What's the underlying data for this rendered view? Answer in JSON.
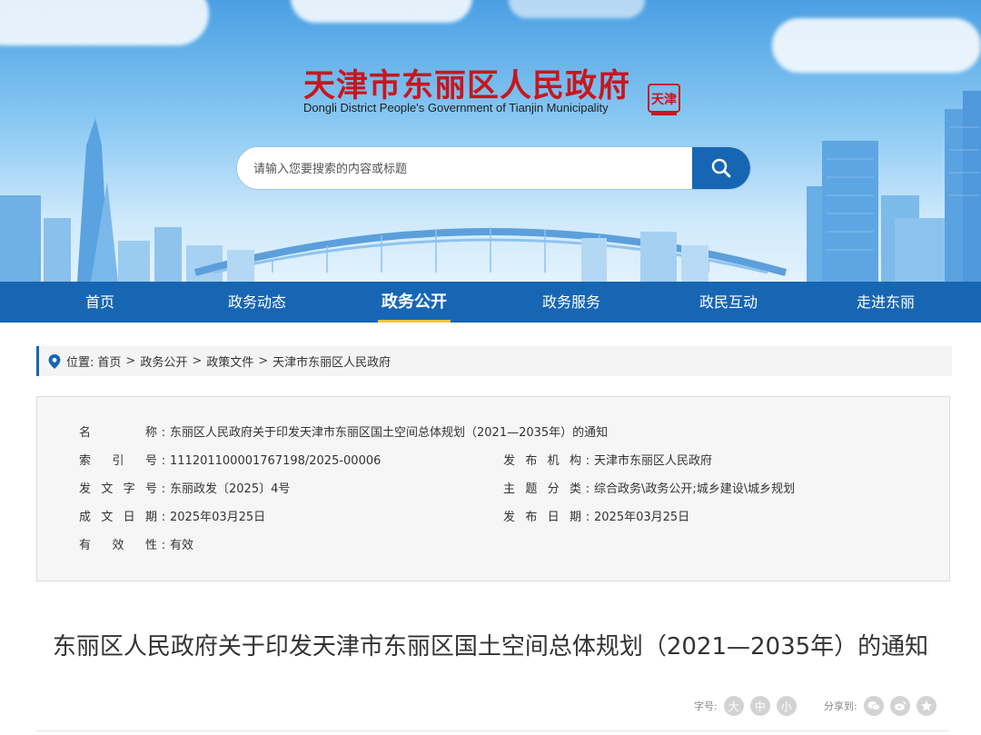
{
  "header": {
    "site_title": "天津市东丽区人民政府",
    "site_subtitle": "Dongli District People's Government of Tianjin Municipality",
    "seal_text": "天津"
  },
  "search": {
    "placeholder": "请输入您要搜索的内容或标题",
    "value": ""
  },
  "nav": {
    "items": [
      {
        "label": "首页"
      },
      {
        "label": "政务动态"
      },
      {
        "label": "政务公开"
      },
      {
        "label": "政务服务"
      },
      {
        "label": "政民互动"
      },
      {
        "label": "走进东丽"
      }
    ],
    "active": "政务公开"
  },
  "breadcrumb": {
    "prefix": "位置:",
    "items": [
      "首页",
      "政务公开",
      "政策文件",
      "天津市东丽区人民政府"
    ],
    "separator": ">"
  },
  "meta": {
    "name_label": "名称",
    "name_value": "东丽区人民政府关于印发天津市东丽区国土空间总体规划（2021—2035年）的通知",
    "index_label": "索引号",
    "index_value": "111201100001767198/2025-00006",
    "issuer_label": "发布机构",
    "issuer_value": "天津市东丽区人民政府",
    "doc_no_label": "发文字号",
    "doc_no_value": "东丽政发〔2025〕4号",
    "topic_label": "主题分类",
    "topic_value": "综合政务\\政务公开;城乡建设\\城乡规划",
    "created_label": "成文日期",
    "created_value": "2025年03月25日",
    "published_label": "发布日期",
    "published_value": "2025年03月25日",
    "validity_label": "有效性",
    "validity_value": "有效",
    "colon": ":"
  },
  "article": {
    "title": "东丽区人民政府关于印发天津市东丽区国土空间总体规划（2021—2035年）的通知"
  },
  "tools": {
    "font_size_label": "字号:",
    "size_large": "大",
    "size_medium": "中",
    "size_small": "小",
    "share_label": "分享到:",
    "share_icons": [
      "wechat-icon",
      "weibo-icon",
      "favorite-icon"
    ]
  },
  "colors": {
    "brand_blue": "#1766b3",
    "title_red": "#c8161d",
    "nav_underline": "#f5c542"
  }
}
